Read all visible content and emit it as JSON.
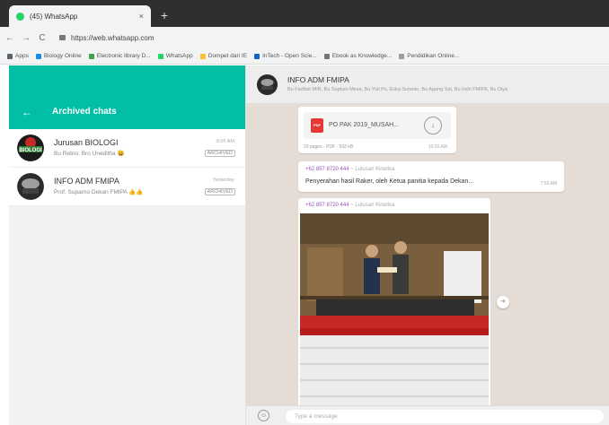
{
  "browser": {
    "tab_title": "(45) WhatsApp",
    "tab_close": "×",
    "new_tab": "+",
    "url": "https://web.whatsapp.com",
    "nav_back": "←",
    "nav_forward": "→",
    "nav_reload": "C"
  },
  "bookmarks": [
    {
      "label": "Apps",
      "color": "#5f6368"
    },
    {
      "label": "Biology Online",
      "color": "#1e88e5"
    },
    {
      "label": "Electronic library D...",
      "color": "#43a047"
    },
    {
      "label": "WhatsApp",
      "color": "#25d366"
    },
    {
      "label": "Dompet dari IE",
      "color": "#fbc02d"
    },
    {
      "label": "InTech - Open Scie...",
      "color": "#1565c0"
    },
    {
      "label": "Ebook as Knowledge...",
      "color": "#757575"
    },
    {
      "label": "Pendidikan Online...",
      "color": "#9e9e9e"
    }
  ],
  "sidebar": {
    "back_icon": "arrow-left-icon",
    "title": "Archived chats",
    "chats": [
      {
        "name": "Jurusan BIOLOGI",
        "preview": "Bu Retno: Bro Uneditha 😀",
        "time": "8:05 AM",
        "badge": "ARCHIVED"
      },
      {
        "name": "INFO ADM FMIPA",
        "preview": "Prof. Suparno Dekan FMIPA 👍👍",
        "time": "Yesterday",
        "badge": "ARCHIVED"
      }
    ]
  },
  "conversation": {
    "name": "INFO ADM FMIPA",
    "members": "Bu Fadilah MIB, Bu Saptuni Mesa, Bu Yuli Ps, Eska Sutanto, Bu Agung Sal, Bu Indri FMIPA, Bu Diya",
    "doc_message": {
      "filename": "PO PAK 2019_MUSAH...",
      "meta": "20 pages · PDF · 593 kB",
      "time": "10:30 AM",
      "file_type": "PDF"
    },
    "text_message": {
      "sender": "+62 857 8720 444",
      "sender_alias": "~ Lulusan Kinetika",
      "text": "Penyerahan hasil Raker, oleh Ketua panitia kepada Dekan...",
      "time": "7:50 AM"
    },
    "image_message": {
      "sender": "+62 857 8720 444",
      "sender_alias": "~ Lulusan Kinetika"
    }
  },
  "composer": {
    "placeholder": "Type a message",
    "emoji_icon": "smiley-icon"
  },
  "colors": {
    "header_teal": "#00bfa5",
    "chat_background": "#e5ddd5",
    "sender_purple": "#9c56b8"
  }
}
